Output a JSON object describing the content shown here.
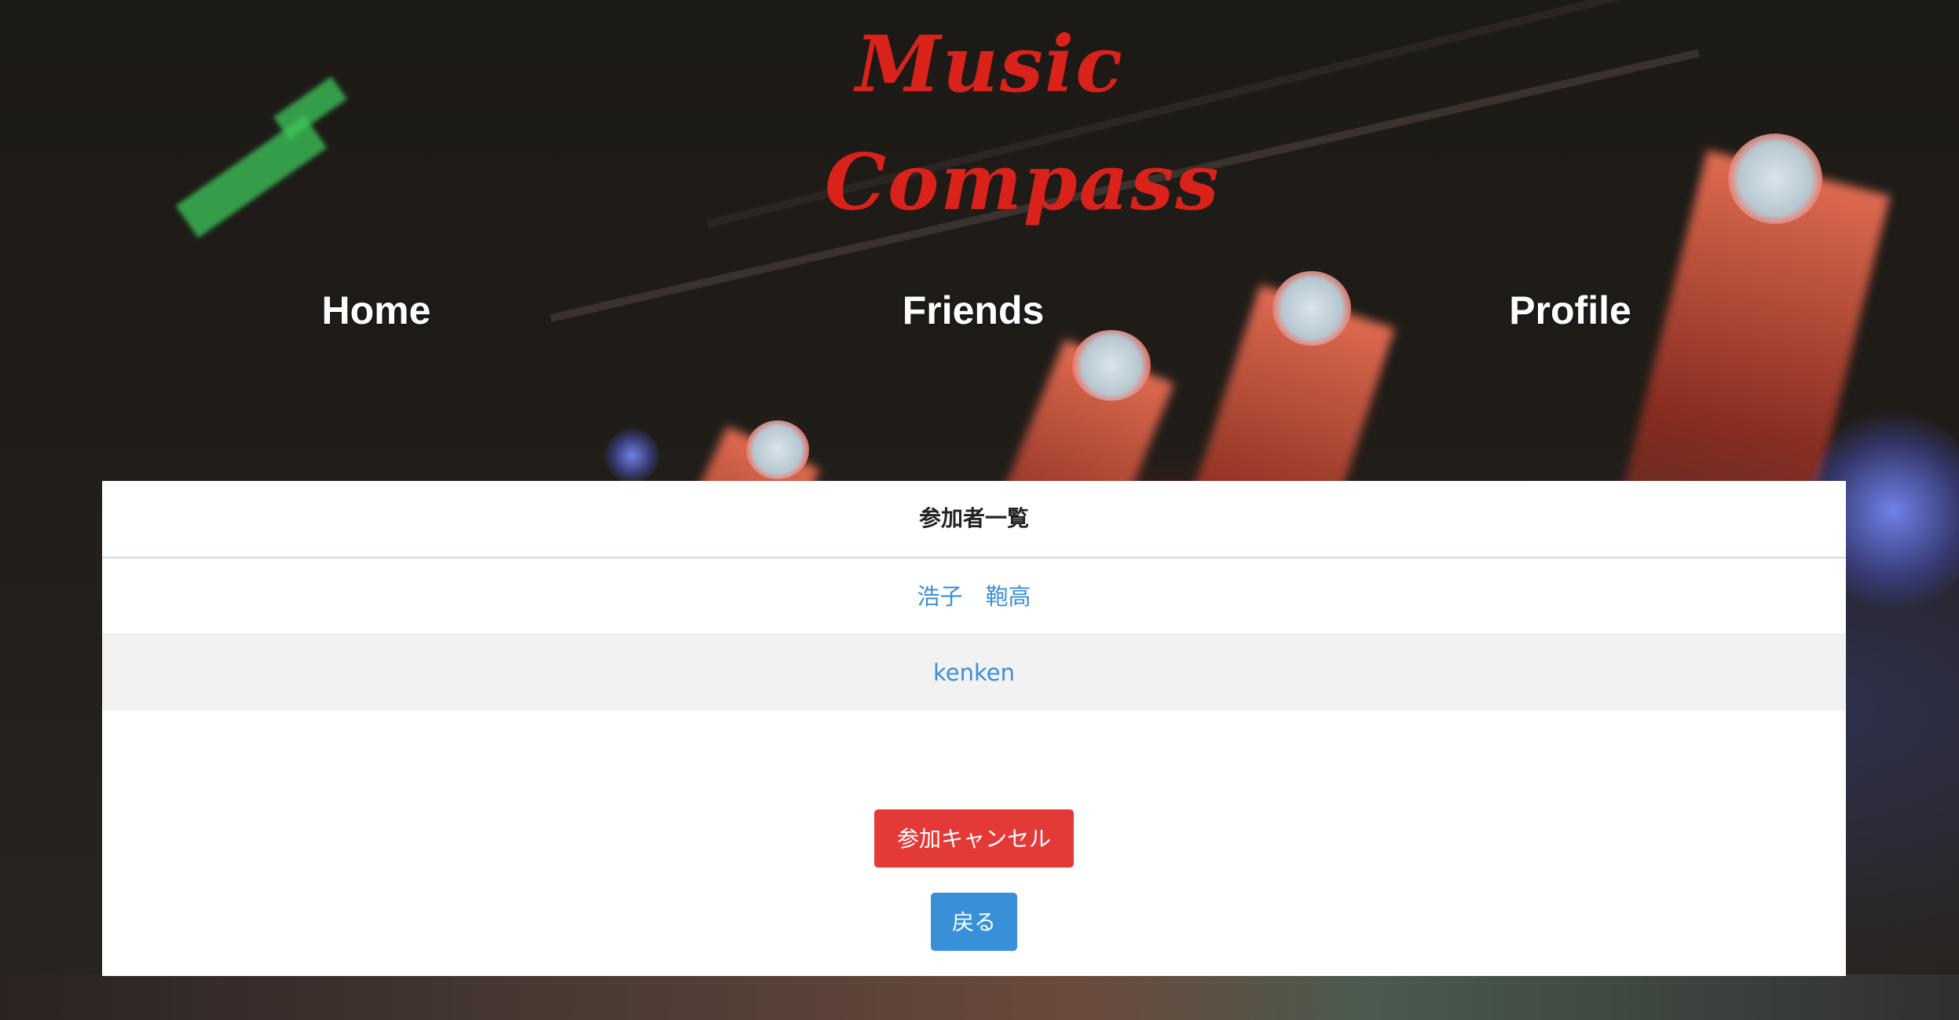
{
  "app": {
    "logo_line1": "Music",
    "logo_line2": "Compass"
  },
  "nav": {
    "home": "Home",
    "friends": "Friends",
    "profile": "Profile"
  },
  "participants": {
    "title": "参加者一覧",
    "members": [
      "浩子　鞄高",
      "kenken"
    ]
  },
  "actions": {
    "cancel_label": "参加キャンセル",
    "back_label": "戻る"
  },
  "colors": {
    "logo": "#d8221a",
    "cancel": "#e33a37",
    "back": "#3790d8",
    "link": "#3a8fd9"
  }
}
